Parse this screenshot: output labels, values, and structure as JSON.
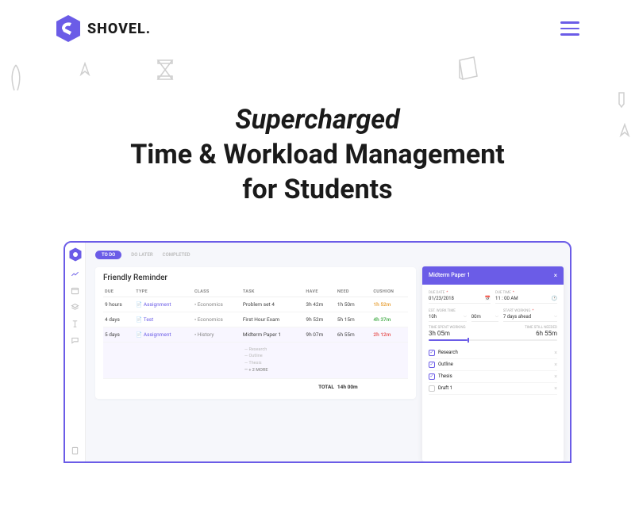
{
  "brand": "SHOVEL.",
  "hero": {
    "line1": "Supercharged",
    "line2": "Time & Workload Management",
    "line3": "for Students"
  },
  "mock": {
    "tabs": {
      "active": "TO DO",
      "t2": "DO LATER",
      "t3": "COMPLETED"
    },
    "card_title": "Friendly Reminder",
    "cols": {
      "due": "DUE",
      "type": "TYPE",
      "class": "CLASS",
      "task": "TASK",
      "have": "HAVE",
      "need": "NEED",
      "cushion": "CUSHION"
    },
    "rows": [
      {
        "due": "9 hours",
        "type_icon": "doc",
        "type": "Assignment",
        "class": "Economics",
        "task": "Problem set 4",
        "have": "3h 42m",
        "need": "1h 50m",
        "cushion": "1h 52m",
        "cush_class": "cush-warn"
      },
      {
        "due": "4 days",
        "type_icon": "doc",
        "type": "Test",
        "class": "Economics",
        "task": "First Hour Exam",
        "have": "9h 52m",
        "need": "5h 15m",
        "cushion": "4h 37m",
        "cush_class": "cush-ok"
      },
      {
        "due": "5 days",
        "type_icon": "doc",
        "type": "Assignment",
        "class": "History",
        "task": "Midterm Paper 1",
        "have": "9h 07m",
        "need": "6h 55m",
        "cushion": "2h 12m",
        "cush_class": "cush-danger"
      }
    ],
    "subtasks": {
      "s1": "Research",
      "s2": "Outline",
      "s3": "Thesis",
      "more": "+ 2 MORE"
    },
    "total_label": "TOTAL",
    "total_need": "14h 00m",
    "panel": {
      "title": "Midterm Paper 1",
      "due_date_label": "DUE DATE",
      "due_date": "01/23/2018",
      "due_time_label": "DUE TIME",
      "due_time": "11 : 00 AM",
      "est_label": "EST. WORK TIME",
      "est_h": "10h",
      "est_m": "00m",
      "start_label": "START WORKING",
      "start_val": "7 days ahead",
      "spent_label": "TIME SPENT WORKING",
      "spent_val": "3h 05m",
      "need_label": "TIME STILL NEEDED",
      "need_val": "6h 55m",
      "items": [
        {
          "label": "Research",
          "checked": true
        },
        {
          "label": "Outline",
          "checked": true
        },
        {
          "label": "Thesis",
          "checked": true
        },
        {
          "label": "Draft 1",
          "checked": false
        }
      ]
    }
  }
}
